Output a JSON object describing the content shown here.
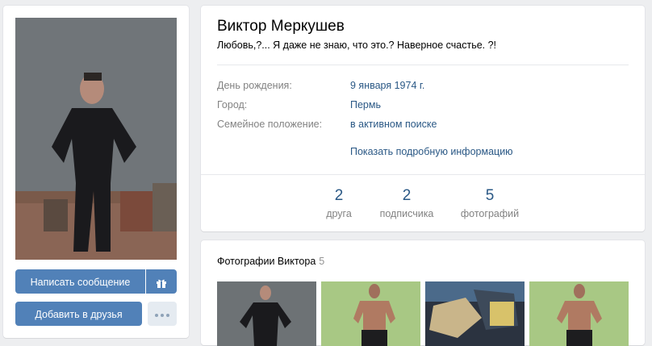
{
  "profile": {
    "name": "Виктор Меркушев",
    "status": "Любовь,?... Я даже не знаю, что это.? Наверное счастье. ?!"
  },
  "info": {
    "birthday_label": "День рождения:",
    "birthday_value": "9 января 1974 г.",
    "city_label": "Город:",
    "city_value": "Пермь",
    "family_label": "Семейное положение:",
    "family_value": "в активном поиске",
    "more_link": "Показать подробную информацию"
  },
  "counters": [
    {
      "num": "2",
      "caption": "друга"
    },
    {
      "num": "2",
      "caption": "подписчика"
    },
    {
      "num": "5",
      "caption": "фотографий"
    }
  ],
  "actions": {
    "message_label": "Написать сообщение",
    "add_friend_label": "Добавить в друзья",
    "gift_icon": "gift-icon",
    "more_icon": "more-dots-icon"
  },
  "photos": {
    "title": "Фотографии Виктора",
    "count": "5"
  },
  "colors": {
    "accent": "#5181b8",
    "link": "#2a5885",
    "background": "#edeef0"
  }
}
